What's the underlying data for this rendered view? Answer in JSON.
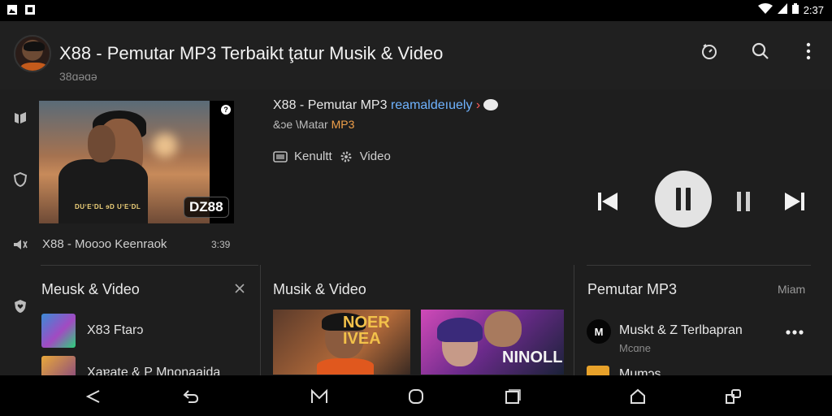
{
  "statusbar": {
    "time": "2:37"
  },
  "header": {
    "title": "X88 - Pemutar MP3 Terbaikt ţatur Musik & Video",
    "subtitle": "38ɑəɑə"
  },
  "featured": {
    "badge": "DZ88",
    "caption": "DUʼEʼDL ɘD UʼEʼDL",
    "help": "?"
  },
  "now_playing": {
    "title_main": "X88 - Pemutar MP3 ",
    "title_highlight": "reamaldeıuely",
    "title_arrow": " ›",
    "artist_prefix": "&ɔe \\Matar ",
    "artist_accent": "MP3",
    "tags": [
      "Kenultt",
      "Video"
    ]
  },
  "mini_player": {
    "label": "X88  -  Mooɔo  Keenraok",
    "time": "3:39"
  },
  "sections": {
    "left": {
      "title": "Meusk & Video",
      "items": [
        {
          "label": "X83  Ftarɔ"
        },
        {
          "label": "Xaɐate & P Mnonaaida"
        }
      ]
    },
    "center": {
      "title": "Musik & Video",
      "cards": [
        {
          "overlay": "NOER\nIVEA"
        },
        {
          "overlay": "NINOLL"
        }
      ]
    },
    "right": {
      "title": "Pemutar MP3",
      "link": "Miam",
      "items": [
        {
          "initial": "M",
          "title": "Muskt & Z  Terlbapran",
          "subtitle": "Mcɑne"
        },
        {
          "title": "Mumɔs"
        }
      ]
    }
  },
  "colors": {
    "accent_blue": "#6fb3ff",
    "accent_orange": "#f0a04a",
    "bg": "#1e1e1e"
  }
}
